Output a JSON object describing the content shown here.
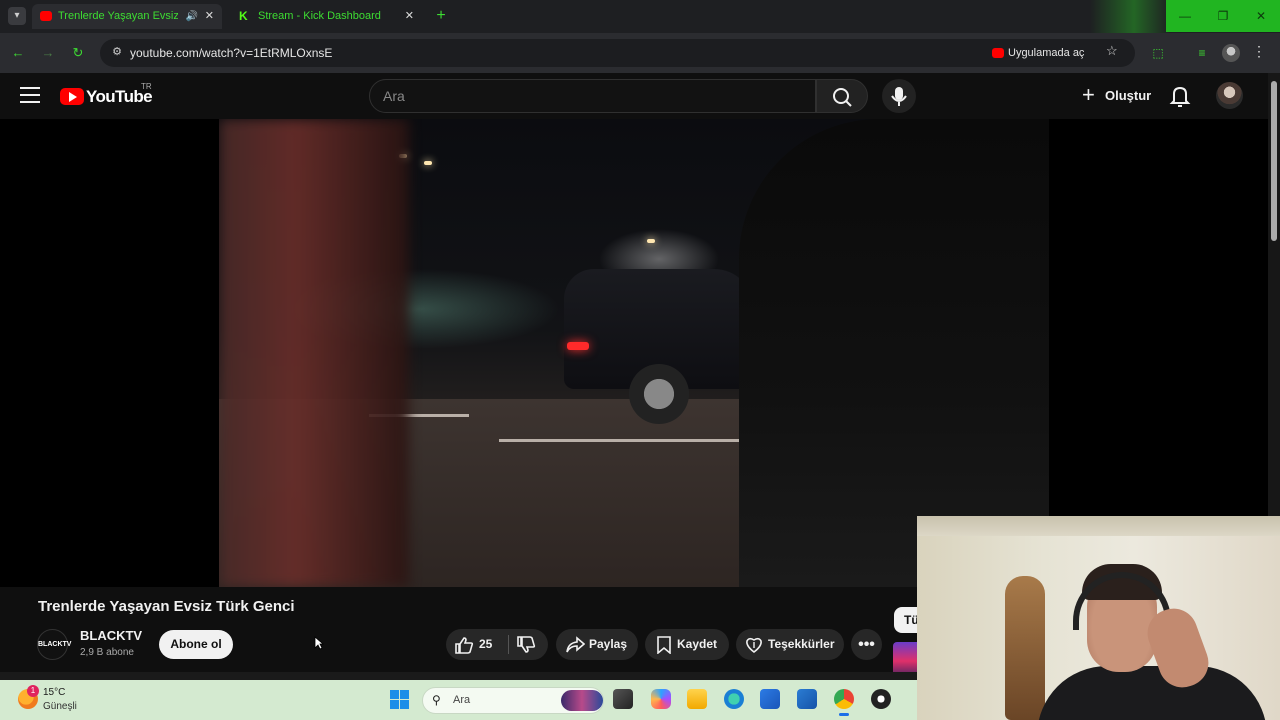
{
  "browser": {
    "tabs": [
      {
        "title": "Trenlerde Yaşayan Evsiz Türk",
        "favicon": "youtube-icon",
        "audio": true,
        "active": true
      },
      {
        "title": "Stream - Kick Dashboard",
        "favicon": "kick-icon",
        "audio": false,
        "active": false
      }
    ],
    "url": "youtube.com/watch?v=1EtRMLOxnsE",
    "open_in_app_label": "Uygulamada aç",
    "accent_color": "#3ddc32",
    "window_controls_color": "#21b521"
  },
  "youtube": {
    "logo_text": "YouTube",
    "country_code": "TR",
    "search_placeholder": "Ara",
    "create_label": "Oluştur"
  },
  "video": {
    "title": "Trenlerde Yaşayan Evsiz Türk Genci",
    "channel": {
      "name": "BLACKTV",
      "avatar_text": "BLACKTV",
      "subscribers": "2,9 B abone"
    },
    "subscribe_label": "Abone ol",
    "likes": "25",
    "share_label": "Paylaş",
    "save_label": "Kaydet",
    "thanks_label": "Teşekkürler",
    "chip_label": "Tü"
  },
  "taskbar": {
    "weather_badge": "1",
    "temperature": "15°C",
    "condition": "Güneşli",
    "search_placeholder": "Ara",
    "apps": [
      "file-explorer-icon",
      "copilot-icon",
      "folder-icon",
      "edge-icon",
      "store-icon",
      "outlook-icon",
      "chrome-icon",
      "obs-icon"
    ]
  }
}
